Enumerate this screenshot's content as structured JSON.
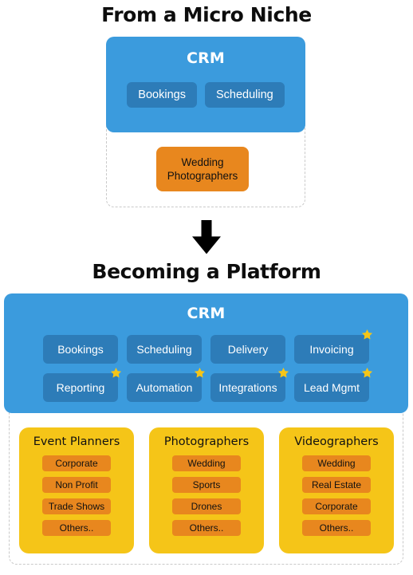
{
  "top_section": {
    "title": "From a Micro Niche",
    "crm": {
      "title": "CRM",
      "features": [
        {
          "label": "Bookings",
          "starred": false
        },
        {
          "label": "Scheduling",
          "starred": false
        }
      ]
    },
    "niche": {
      "line1": "Wedding",
      "line2": "Photographers"
    }
  },
  "arrow": {
    "icon": "arrow-down-icon"
  },
  "bottom_section": {
    "title": "Becoming a Platform",
    "crm": {
      "title": "CRM",
      "features_row1": [
        {
          "label": "Bookings",
          "starred": false
        },
        {
          "label": "Scheduling",
          "starred": false
        },
        {
          "label": "Delivery",
          "starred": false
        },
        {
          "label": "Invoicing",
          "starred": true
        }
      ],
      "features_row2": [
        {
          "label": "Reporting",
          "starred": true
        },
        {
          "label": "Automation",
          "starred": true
        },
        {
          "label": "Integrations",
          "starred": true
        },
        {
          "label": "Lead Mgmt",
          "starred": true
        }
      ]
    },
    "audience_cards": [
      {
        "title": "Event Planners",
        "tags": [
          "Corporate",
          "Non Profit",
          "Trade Shows",
          "Others.."
        ]
      },
      {
        "title": "Photographers",
        "tags": [
          "Wedding",
          "Sports",
          "Drones",
          "Others.."
        ]
      },
      {
        "title": "Videographers",
        "tags": [
          "Wedding",
          "Real Estate",
          "Corporate",
          "Others.."
        ]
      }
    ]
  },
  "colors": {
    "panel_blue": "#3b9bdd",
    "chip_blue": "#2d7cb8",
    "card_yellow": "#f5c518",
    "tag_orange": "#e8871e",
    "star_yellow": "#f5c518",
    "dashed_border": "#c9c9c9",
    "text_dark": "#111111",
    "background": "#ffffff"
  }
}
